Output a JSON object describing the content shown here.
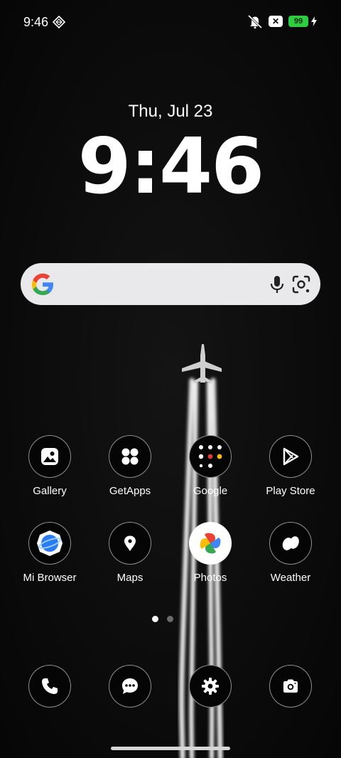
{
  "status_bar": {
    "time": "9:46",
    "battery": "99",
    "icons": [
      "cast-diamond-icon",
      "mute-icon",
      "close-notification-icon",
      "battery-icon",
      "charging-bolt-icon"
    ],
    "battery_color": "#2ecc40"
  },
  "lock": {
    "date": "Thu, Jul 23",
    "clock": "9:46"
  },
  "search": {
    "icons": [
      "google-logo-icon",
      "microphone-icon",
      "google-lens-icon"
    ]
  },
  "apps": {
    "gallery": "Gallery",
    "getapps": "GetApps",
    "google": "Google",
    "playstore": "Play Store",
    "browser": "Mi Browser",
    "maps": "Maps",
    "photos": "Photos",
    "weather": "Weather"
  },
  "dock": {
    "icons": [
      "phone-icon",
      "messages-icon",
      "settings-icon",
      "camera-icon"
    ]
  },
  "pages": {
    "count": 2,
    "active": 1
  }
}
